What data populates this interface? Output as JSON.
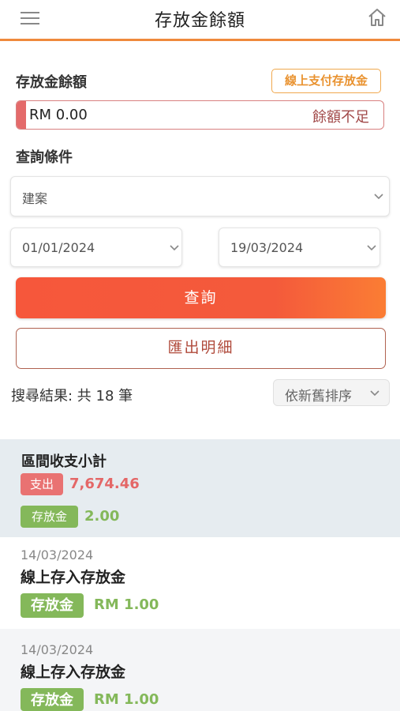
{
  "header": {
    "title": "存放金餘額",
    "menu_icon": "hamburger-menu-icon",
    "home_icon": "home-icon",
    "accent_color": "#ef8a3c"
  },
  "balance": {
    "label": "存放金餘額",
    "pay_button": "線上支付存放金",
    "amount": "RM 0.00",
    "status": "餘額不足"
  },
  "query": {
    "label": "查詢條件",
    "project_placeholder": "建案",
    "start_date": "01/01/2024",
    "end_date": "19/03/2024",
    "query_button": "查詢",
    "export_button": "匯出明細"
  },
  "results": {
    "summary_text": "搜尋結果: 共 18 筆",
    "sort_value": "依新舊排序"
  },
  "summary": {
    "title": "區間收支小計",
    "expense_tag": "支出",
    "expense_amount": "7,674.46",
    "deposit_tag": "存放金",
    "deposit_amount": "2.00"
  },
  "transactions": [
    {
      "date": "14/03/2024",
      "title": "線上存入存放金",
      "tag": "存放金",
      "amount": "RM 1.00"
    },
    {
      "date": "14/03/2024",
      "title": "線上存入存放金",
      "tag": "存放金",
      "amount": "RM 1.00"
    }
  ]
}
